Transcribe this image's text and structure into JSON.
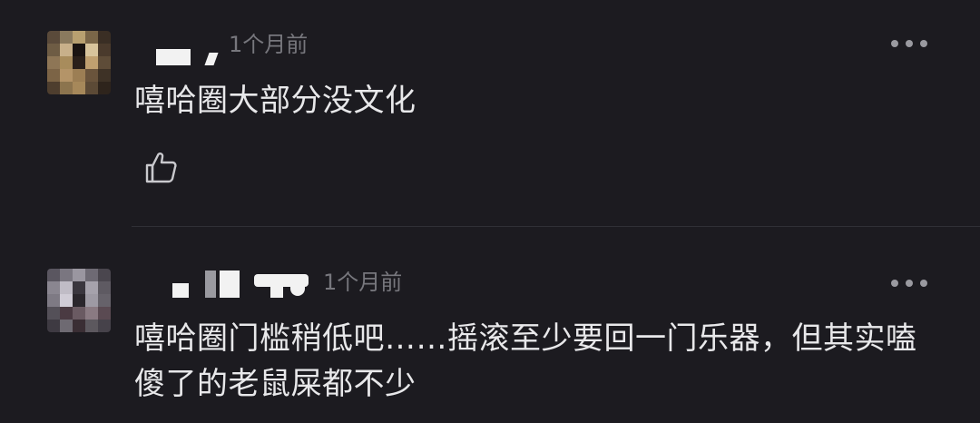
{
  "comments": [
    {
      "time": "1个月前",
      "text": "嘻哈圈大部分没文化",
      "avatar_colors": [
        "#5a4a3a",
        "#8a7a5e",
        "#b8a070",
        "#7a6648",
        "#3a2e24",
        "#6e5c44",
        "#c8b08a",
        "#1a1412",
        "#d8c49c",
        "#4a3a2c",
        "#8e7656",
        "#a88c5c",
        "#2a201a",
        "#c0a070",
        "#5e4c38",
        "#7c6446",
        "#b49468",
        "#9c7e54",
        "#6a543c",
        "#3e3226",
        "#4e3e2e",
        "#8c744e",
        "#a6885a",
        "#5c4a36",
        "#2e241c"
      ]
    },
    {
      "time": "1个月前",
      "text": "嘻哈圈门槛稍低吧……摇滚至少要回一门乐器，但其实嗑傻了的老鼠屎都不少",
      "avatar_colors": [
        "#5a5660",
        "#7a7680",
        "#9a96a0",
        "#6e6a74",
        "#4a464e",
        "#8a8690",
        "#c0bcc6",
        "#3a363e",
        "#a6a2ac",
        "#5e5a62",
        "#7e7a84",
        "#d0ccd6",
        "#2a262c",
        "#9e9aa4",
        "#66626a",
        "#545058",
        "#4a3a42",
        "#6a5a62",
        "#8a7a82",
        "#5a4a52",
        "#3e3a42",
        "#6e6a72",
        "#3a2e34",
        "#5c585e",
        "#46424a"
      ]
    }
  ]
}
